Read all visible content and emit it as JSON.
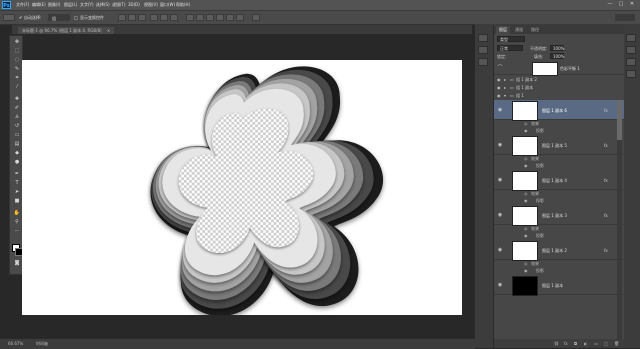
{
  "app": {
    "logo": "Ps"
  },
  "menu": [
    "文件(F)",
    "编辑(E)",
    "图像(I)",
    "图层(L)",
    "文字(Y)",
    "选择(S)",
    "滤镜(T)",
    "3D(D)",
    "视图(V)",
    "窗口(W)",
    "帮助(H)"
  ],
  "window_controls": {
    "minimize": "—",
    "maximize": "□",
    "close": "✕"
  },
  "options_bar": {
    "auto_select_label": "自动选择:",
    "auto_select_value": "组",
    "show_transform_label": "显示变换控件"
  },
  "document": {
    "tab_label": "未标题-1 @ 66.7% (图层 1 副本 4, RGB/8)"
  },
  "status": {
    "zoom": "66.67%",
    "timeline": "时间轴"
  },
  "layers_panel": {
    "tabs": [
      "图层",
      "通道",
      "路径"
    ],
    "filter": "类型",
    "blend_mode": "正常",
    "opacity_label": "不透明度:",
    "opacity_value": "100%",
    "lock_label": "锁定:",
    "fill_label": "填充:",
    "fill_value": "100%",
    "groups": [
      {
        "name": "组 1 副本 2"
      },
      {
        "name": "组 1 副本"
      },
      {
        "name": "组 1"
      }
    ],
    "top_layer_name": "色彩平衡 1",
    "layers": [
      {
        "name": "图层 1 副本 6",
        "fx": "fx",
        "effects_label": "效果",
        "effect": "投影",
        "selected": true
      },
      {
        "name": "图层 1 副本 5",
        "fx": "fx",
        "effects_label": "效果",
        "effect": "投影",
        "selected": false
      },
      {
        "name": "图层 1 副本 4",
        "fx": "fx",
        "effects_label": "效果",
        "effect": "投影",
        "selected": false
      },
      {
        "name": "图层 1 副本 3",
        "fx": "fx",
        "effects_label": "效果",
        "effect": "投影",
        "selected": false
      },
      {
        "name": "图层 1 副本 2",
        "fx": "fx",
        "effects_label": "效果",
        "effect": "投影",
        "selected": false
      },
      {
        "name": "图层 1 副本",
        "fx": "",
        "effects_label": "",
        "effect": "",
        "selected": false
      }
    ]
  },
  "colors": {
    "foreground": "#ffffff",
    "background": "#000000",
    "selection": "#5a6a85"
  }
}
